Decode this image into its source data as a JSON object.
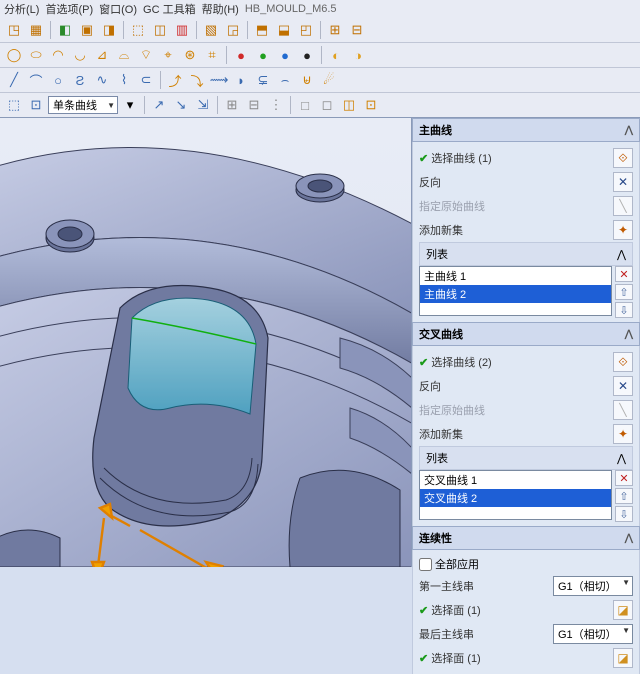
{
  "menu": {
    "items": [
      "分析(L)",
      "首选项(P)",
      "窗口(O)",
      "GC 工具箱",
      "帮助(H)"
    ],
    "title": "HB_MOULD_M6.5"
  },
  "curve_type": {
    "value": "单条曲线"
  },
  "panel_main": {
    "title": "主曲线",
    "select_label": "选择曲线 (1)",
    "reverse": "反向",
    "orig": "指定原始曲线",
    "add_set": "添加新集",
    "list_title": "列表",
    "items": [
      {
        "label": "主曲线 1",
        "sel": false
      },
      {
        "label": "主曲线 2",
        "sel": true
      }
    ]
  },
  "panel_cross": {
    "title": "交叉曲线",
    "select_label": "选择曲线 (2)",
    "reverse": "反向",
    "orig": "指定原始曲线",
    "add_set": "添加新集",
    "list_title": "列表",
    "items": [
      {
        "label": "交叉曲线 1",
        "sel": false
      },
      {
        "label": "交叉曲线 2",
        "sel": true
      }
    ]
  },
  "panel_cont": {
    "title": "连续性",
    "all_apply": "全部应用",
    "first_main": "第一主线串",
    "select_face1": "选择面 (1)",
    "last_main": "最后主线串",
    "select_face2": "选择面 (1)",
    "g1_label": "G1（相切）"
  }
}
